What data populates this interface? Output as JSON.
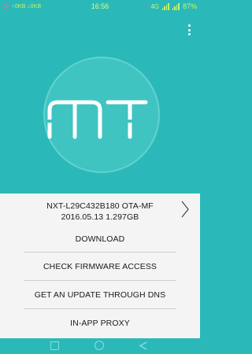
{
  "status_bar": {
    "alert_text": "0²",
    "net_speed": "↑0KB ↓0KB",
    "time": "16:56",
    "signal_label": "4G",
    "battery": "87%"
  },
  "app": {
    "logo_text": "MT",
    "accent_color": "#2ab9b8"
  },
  "firmware": {
    "version_line1": "NXT-L29C432B180 OTA-MF",
    "version_line2": "2016.05.13 1.297GB"
  },
  "menu": [
    {
      "label": "DOWNLOAD"
    },
    {
      "label": "CHECK FIRMWARE ACCESS"
    },
    {
      "label": "GET AN UPDATE THROUGH DNS"
    },
    {
      "label": "IN-APP PROXY"
    }
  ],
  "icons": {
    "overflow": "overflow-menu-icon",
    "chevron": "chevron-right-icon",
    "back": "back-icon",
    "home": "home-icon",
    "recent": "recent-apps-icon"
  }
}
